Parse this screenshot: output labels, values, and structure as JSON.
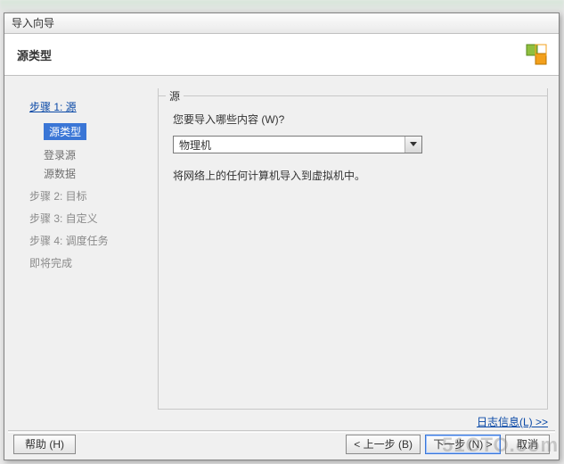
{
  "window": {
    "title": "导入向导"
  },
  "header": {
    "title": "源类型"
  },
  "sidebar": {
    "step1": {
      "label": "步骤 1: 源",
      "subs": [
        "源类型",
        "登录源",
        "源数据"
      ],
      "selected_index": 0
    },
    "step2": "步骤 2: 目标",
    "step3": "步骤 3: 自定义",
    "step4": "步骤 4: 调度任务",
    "step5": "即将完成"
  },
  "group": {
    "legend": "源",
    "prompt": "您要导入哪些内容 (W)?",
    "combo_value": "物理机",
    "description": "将网络上的任何计算机导入到虚拟机中。"
  },
  "log_link": "日志信息(L) >>",
  "buttons": {
    "help": "帮助 (H)",
    "back": "< 上一步 (B)",
    "next": "下一步 (N) >",
    "cancel": "取消"
  },
  "watermark": "51CTO.com"
}
